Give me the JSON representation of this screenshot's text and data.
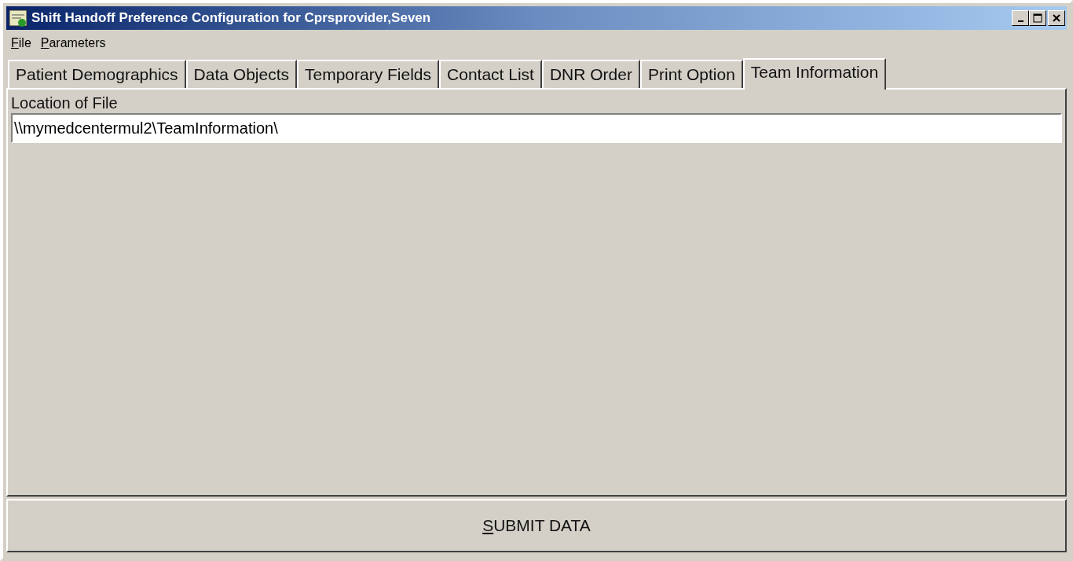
{
  "window": {
    "title": "Shift Handoff Preference Configuration for Cprsprovider,Seven"
  },
  "menu": [
    {
      "label": "File",
      "underline_first": true
    },
    {
      "label": "Parameters",
      "underline_first": true
    }
  ],
  "tabs": [
    {
      "label": "Patient Demographics",
      "selected": false
    },
    {
      "label": "Data Objects",
      "selected": false
    },
    {
      "label": "Temporary Fields",
      "selected": false
    },
    {
      "label": "Contact List",
      "selected": false
    },
    {
      "label": "DNR Order",
      "selected": false
    },
    {
      "label": "Print Option",
      "selected": false
    },
    {
      "label": "Team Information",
      "selected": true
    }
  ],
  "location_field": {
    "label": "Location of File",
    "value": "\\\\mymedcentermul2\\TeamInformation\\"
  },
  "submit_button": {
    "label": "SUBMIT DATA",
    "underline_first": true
  }
}
